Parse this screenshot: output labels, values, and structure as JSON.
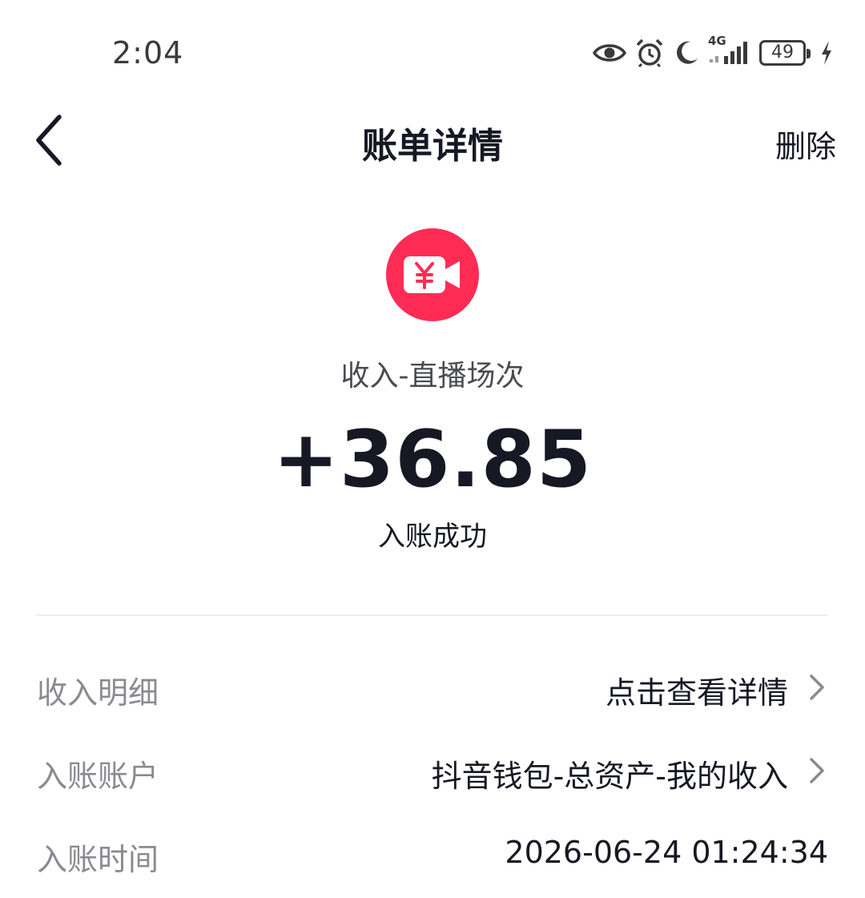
{
  "status_bar": {
    "time": "2:04",
    "network": "4G",
    "battery": "49",
    "icons": [
      "eye-icon",
      "alarm-icon",
      "moon-icon",
      "signal-icon",
      "battery-icon",
      "charging-icon"
    ]
  },
  "header": {
    "title": "账单详情",
    "delete_label": "删除",
    "back_icon": "chevron-left-icon"
  },
  "summary": {
    "icon": "yuan-video-icon",
    "icon_color": "#fe2c55",
    "type_label": "收入-直播场次",
    "amount": "+36.85",
    "status": "入账成功"
  },
  "details": [
    {
      "label": "收入明细",
      "value": "点击查看详情",
      "has_chevron": true
    },
    {
      "label": "入账账户",
      "value": "抖音钱包-总资产-我的收入",
      "has_chevron": true
    },
    {
      "label": "入账时间",
      "value": "2026-06-24 01:24:34",
      "has_chevron": false
    }
  ]
}
